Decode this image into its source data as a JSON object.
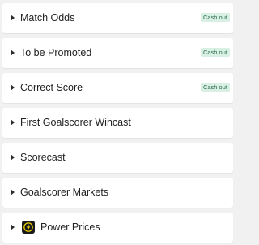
{
  "markets": [
    {
      "label": "Match Odds",
      "badge": "Cash out"
    },
    {
      "label": "To be Promoted",
      "badge": "Cash out"
    },
    {
      "label": "Correct Score",
      "badge": "Cash out"
    },
    {
      "label": "First Goalscorer Wincast"
    },
    {
      "label": "Scorecast"
    },
    {
      "label": "Goalscorer Markets"
    },
    {
      "label": "Power Prices",
      "icon": "power-prices-icon"
    }
  ],
  "colors": {
    "badge_bg": "#d8efe3",
    "badge_text": "#2a6b4d",
    "power_logo_bg": "#1a1a1a",
    "power_logo_bolt": "#f5d800"
  }
}
